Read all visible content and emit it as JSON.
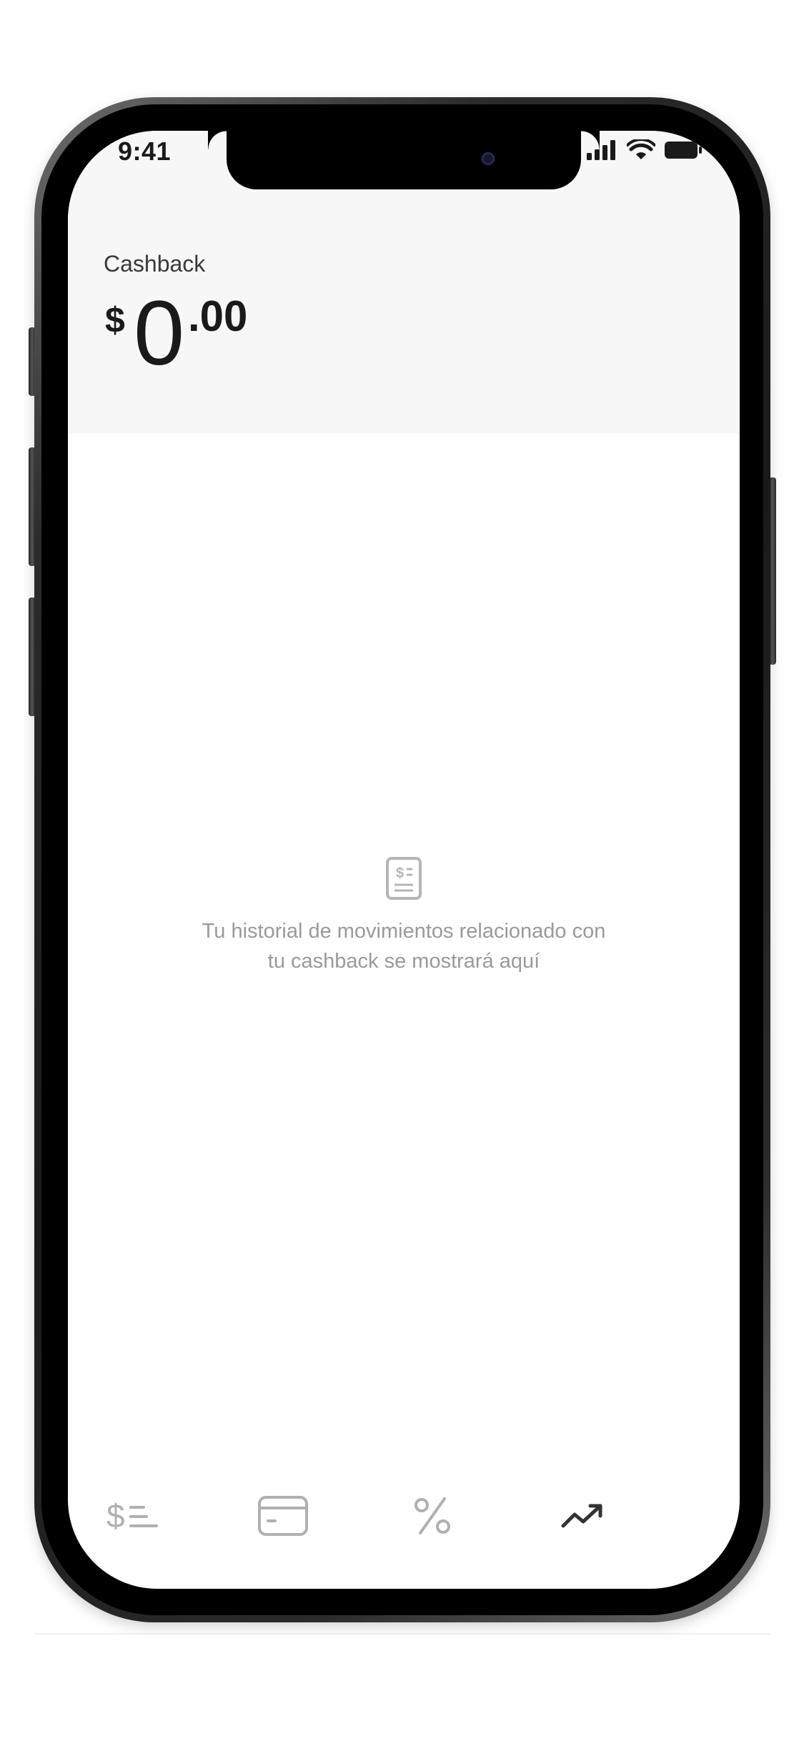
{
  "status_bar": {
    "time": "9:41",
    "icons": [
      "cellular-signal-icon",
      "wifi-icon",
      "battery-icon"
    ]
  },
  "header": {
    "title": "Cashback",
    "balance": {
      "currency": "$",
      "integer": "0",
      "decimal": ".00"
    }
  },
  "empty_state": {
    "icon": "receipt-icon",
    "message_line1": "Tu historial de movimientos relacionado con",
    "message_line2": "tu cashback se mostrará aquí"
  },
  "tab_bar": {
    "tabs": [
      {
        "icon": "transactions-icon",
        "active": false
      },
      {
        "icon": "card-icon",
        "active": false
      },
      {
        "icon": "percent-icon",
        "active": false
      },
      {
        "icon": "trending-up-icon",
        "active": true
      }
    ]
  },
  "colors": {
    "header_bg": "#f7f7f7",
    "text_primary": "#1a1a1a",
    "text_muted": "#9a9a9a",
    "icon_inactive": "#b0b0b0",
    "icon_active": "#333333"
  }
}
